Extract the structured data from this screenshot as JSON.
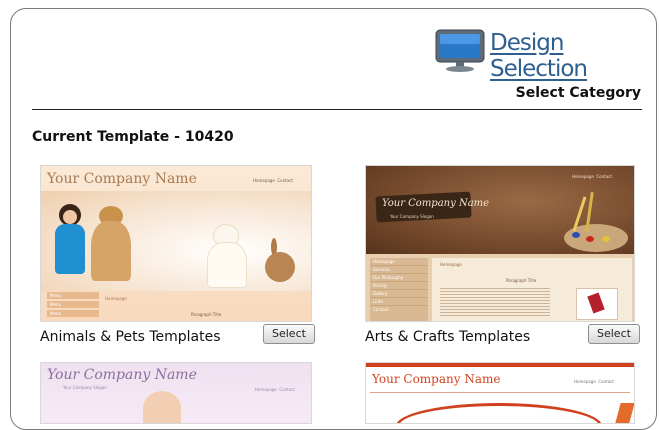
{
  "header": {
    "title": "Design Selection",
    "subtitle": "Select Category"
  },
  "current_template": {
    "label": "Current Template - 10420"
  },
  "templates": [
    {
      "caption": "Animals & Pets Templates",
      "button": "Select",
      "preview": {
        "company_name": "Your Company Name",
        "nav": [
          "Homepage",
          "Contact"
        ],
        "side_menu": [
          "Menu",
          "Menu",
          "Menu"
        ],
        "section": "Homepage",
        "paragraph_title": "Paragraph Title"
      }
    },
    {
      "caption": "Arts & Crafts Templates",
      "button": "Select",
      "preview": {
        "company_name": "Your Company Name",
        "slogan": "Your Company Slogan",
        "nav": [
          "Homepage",
          "Contact"
        ],
        "side_menu": [
          "Homepage",
          "Services",
          "Our Philosophy",
          "Pricing",
          "Gallery",
          "Links",
          "Contact"
        ],
        "section": "Homepage",
        "paragraph_title": "Paragraph Title"
      }
    },
    {
      "caption": "",
      "button": "",
      "preview": {
        "company_name": "Your Company Name",
        "slogan": "Your Company Slogan",
        "nav": [
          "Homepage",
          "Contact"
        ]
      }
    },
    {
      "caption": "",
      "button": "",
      "preview": {
        "company_name": "Your Company Name",
        "nav": [
          "Homepage",
          "Contact"
        ]
      }
    }
  ],
  "colors": {
    "title_blue": "#2f5f8f",
    "monitor_blue": "#2a78c8",
    "red_brand": "#d0421f"
  }
}
